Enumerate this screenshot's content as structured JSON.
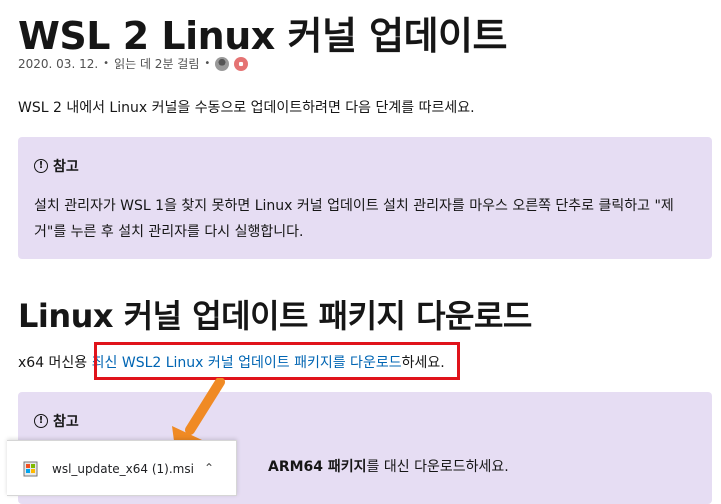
{
  "article": {
    "title": "WSL 2 Linux 커널 업데이트",
    "date": "2020. 03. 12.",
    "reading_time": "읽는 데 2분 걸림",
    "intro": "WSL 2 내에서 Linux 커널을 수동으로 업데이트하려면 다음 단계를 따르세요."
  },
  "note1": {
    "title": "참고",
    "body": "설치 관리자가 WSL 1을 찾지 못하면 Linux 커널 업데이트 설치 관리자를 마우스 오른쪽 단추로 클릭하고 \"제거\"를 누른 후 설치 관리자를 다시 실행합니다."
  },
  "section": {
    "heading": "Linux 커널 업데이트 패키지 다운로드",
    "prefix": "x64 머신용 ",
    "link": "최신 WSL2 Linux 커널 업데이트 패키지를 다운로드",
    "suffix": "하세요."
  },
  "note2": {
    "title": "참고",
    "body_bold": "ARM64 패키지",
    "body_rest": "를 대신 다운로드하세요."
  },
  "download_bar": {
    "file_name": "wsl_update_x64 (1).msi"
  },
  "colors": {
    "note_bg": "#e6ddf3",
    "link": "#0065b3",
    "highlight": "#e0131b",
    "arrow": "#f08a24"
  }
}
